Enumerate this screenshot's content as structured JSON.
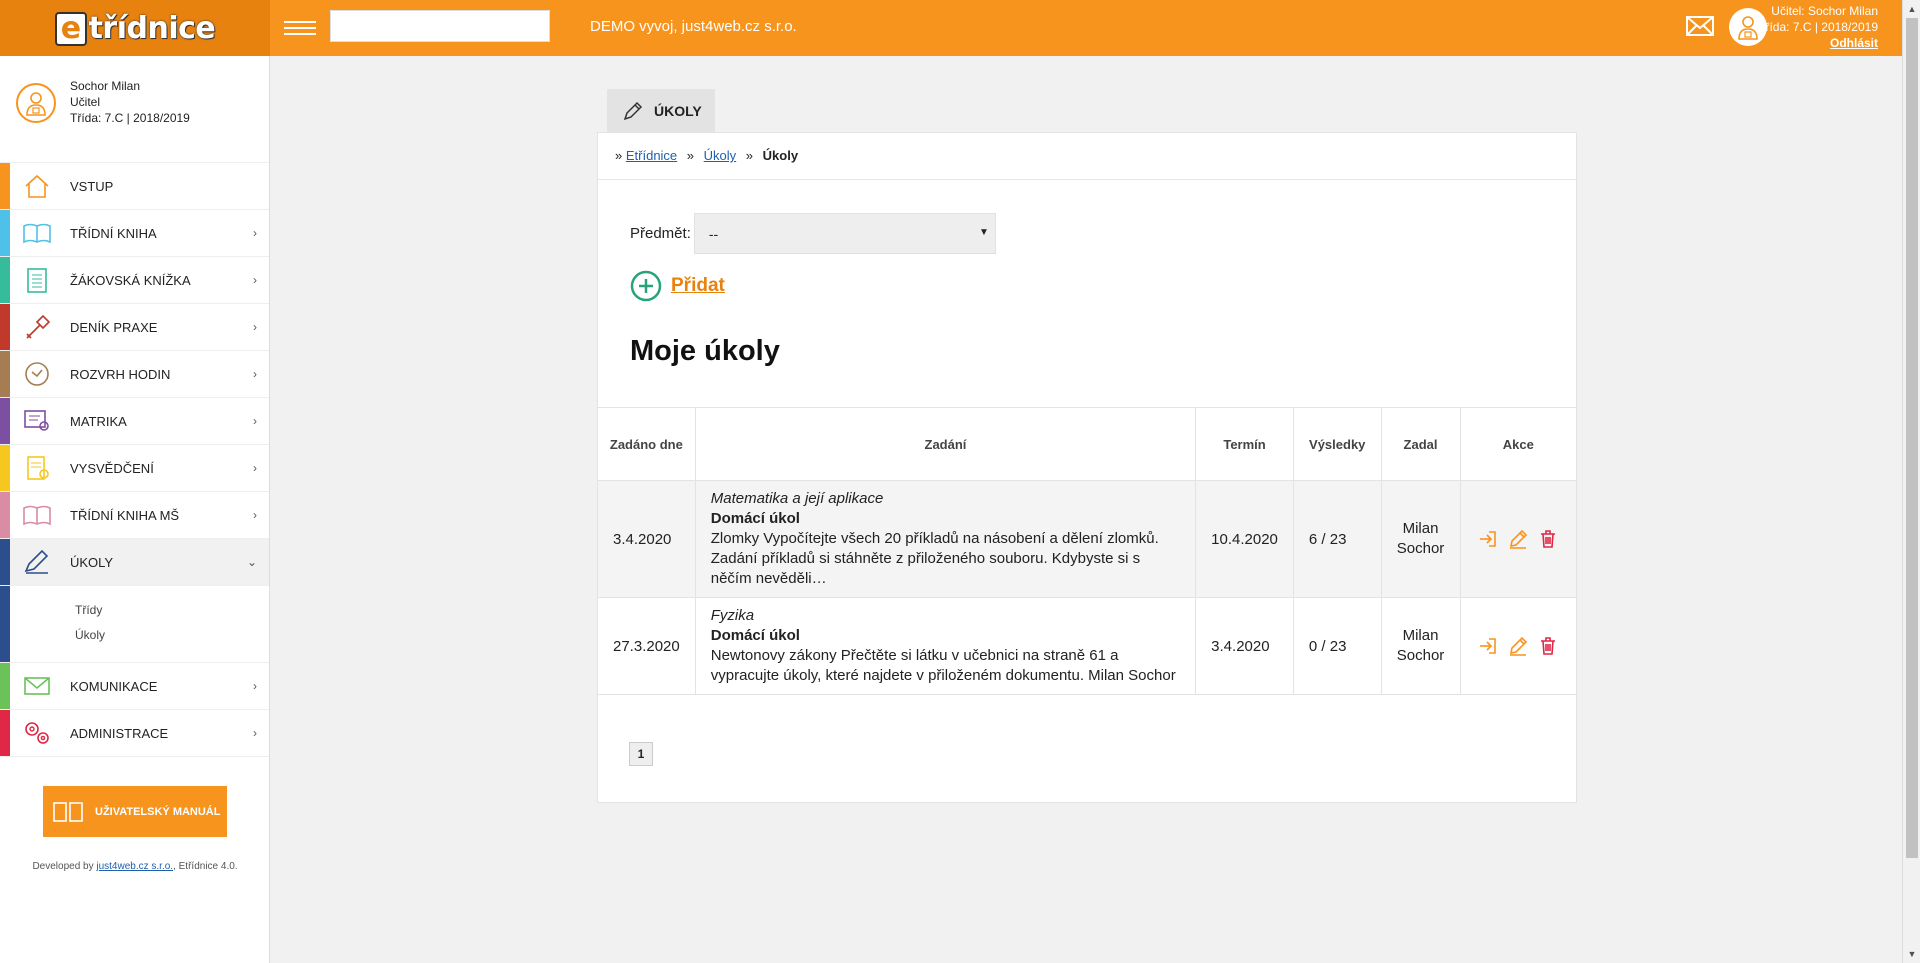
{
  "topbar": {
    "logo": "třídnice",
    "logo_e": "e",
    "search_value": "",
    "demo_text": "DEMO vyvoj, just4web.cz s.r.o.",
    "user_line1": "Učitel: Sochor Milan",
    "user_line2": "Třída: 7.C | 2018/2019",
    "logout": "Odhlásit"
  },
  "profile": {
    "name": "Sochor Milan",
    "role": "Učitel",
    "class": "Třída: 7.C | 2018/2019"
  },
  "sidebar": {
    "items": [
      {
        "label": "VSTUP",
        "color": "#f7941d"
      },
      {
        "label": "TŘÍDNÍ KNIHA",
        "color": "#4fc1e9"
      },
      {
        "label": "ŽÁKOVSKÁ KNÍŽKA",
        "color": "#37bc9b"
      },
      {
        "label": "DENÍK PRAXE",
        "color": "#c0392b"
      },
      {
        "label": "ROZVRH HODIN",
        "color": "#a67c52"
      },
      {
        "label": "MATRIKA",
        "color": "#7d4fa3"
      },
      {
        "label": "VYSVĚDČENÍ",
        "color": "#f6c71e"
      },
      {
        "label": "TŘÍDNÍ KNIHA MŠ",
        "color": "#d98ca3"
      },
      {
        "label": "ÚKOLY",
        "color": "#2d4e8c"
      },
      {
        "label": "KOMUNIKACE",
        "color": "#6ac259"
      },
      {
        "label": "ADMINISTRACE",
        "color": "#e02746"
      }
    ],
    "subitems": [
      "Třídy",
      "Úkoly"
    ],
    "manual_label": "UŽIVATELSKÝ MANUÁL",
    "dev_prefix": "Developed by",
    "dev_link": "just4web.cz s.r.o.",
    "dev_suffix": ", Etřídnice 4.0."
  },
  "main": {
    "tab_label": "ÚKOLY",
    "breadcrumb": {
      "b1": "Etřídnice",
      "b2": "Úkoly",
      "current": "Úkoly",
      "sep": "»"
    },
    "filter_label": "Předmět:",
    "filter_value": "--",
    "add_label": "Přidat",
    "heading": "Moje úkoly",
    "columns": {
      "date": "Zadáno dne",
      "task": "Zadání",
      "term": "Termín",
      "results": "Výsledky",
      "author": "Zadal",
      "actions": "Akce"
    },
    "rows": [
      {
        "date": "3.4.2020",
        "subject": "Matematika a její aplikace",
        "type": "Domácí úkol",
        "desc": "Zlomky Vypočítejte všech 20 příkladů na násobení a dělení zlomků. Zadání příkladů si stáhněte z přiloženého souboru. Kdybyste si s něčím nevěděli…",
        "term": "10.4.2020",
        "results": "6 / 23",
        "author": "Milan Sochor"
      },
      {
        "date": "27.3.2020",
        "subject": "Fyzika",
        "type": "Domácí úkol",
        "desc": "Newtonovy zákony Přečtěte si látku v učebnici na straně 61 a vypracujte úkoly, které najdete v přiloženém dokumentu. Milan Sochor",
        "term": "3.4.2020",
        "results": "0 / 23",
        "author": "Milan Sochor"
      }
    ],
    "page": "1"
  },
  "colors": {
    "accent": "#f7941d",
    "accent_dark": "#e8820f",
    "delete": "#e02746",
    "add_green": "#27a37a"
  }
}
